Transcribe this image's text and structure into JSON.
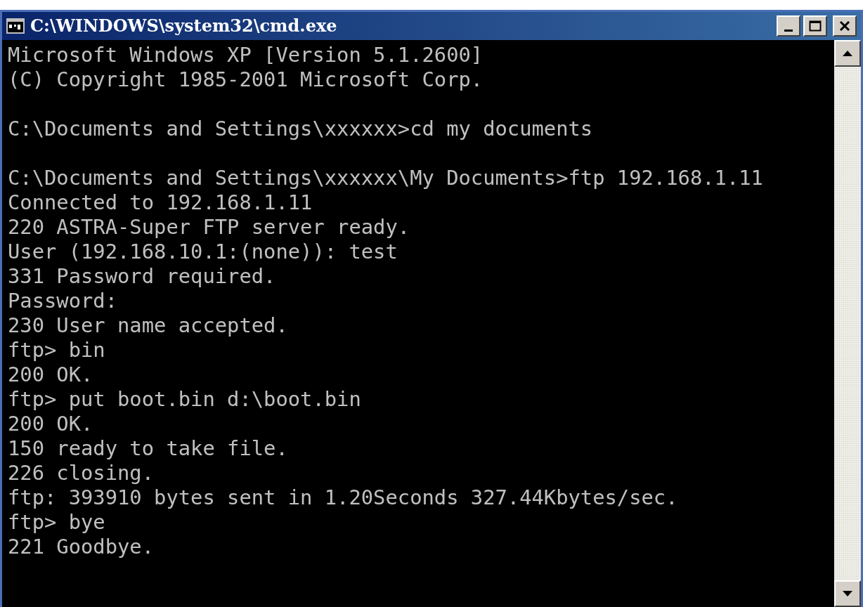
{
  "window": {
    "title": "C:\\WINDOWS\\system32\\cmd.exe"
  },
  "console": {
    "blocks": [
      {
        "lines": [
          "Microsoft Windows XP [Version 5.1.2600]",
          "(C) Copyright 1985-2001 Microsoft Corp."
        ]
      },
      {
        "lines": [
          "C:\\Documents and Settings\\xxxxxx>cd my documents"
        ]
      },
      {
        "lines": [
          "C:\\Documents and Settings\\xxxxxx\\My Documents>ftp 192.168.1.11",
          "Connected to 192.168.1.11",
          "220 ASTRA-Super FTP server ready.",
          "User (192.168.10.1:(none)): test",
          "331 Password required.",
          "Password:",
          "230 User name accepted.",
          "ftp> bin",
          "200 OK.",
          "ftp> put boot.bin d:\\boot.bin",
          "200 OK.",
          "150 ready to take file.",
          "226 closing.",
          "ftp: 393910 bytes sent in 1.20Seconds 327.44Kbytes/sec.",
          "ftp> bye",
          "221 Goodbye."
        ]
      }
    ]
  }
}
